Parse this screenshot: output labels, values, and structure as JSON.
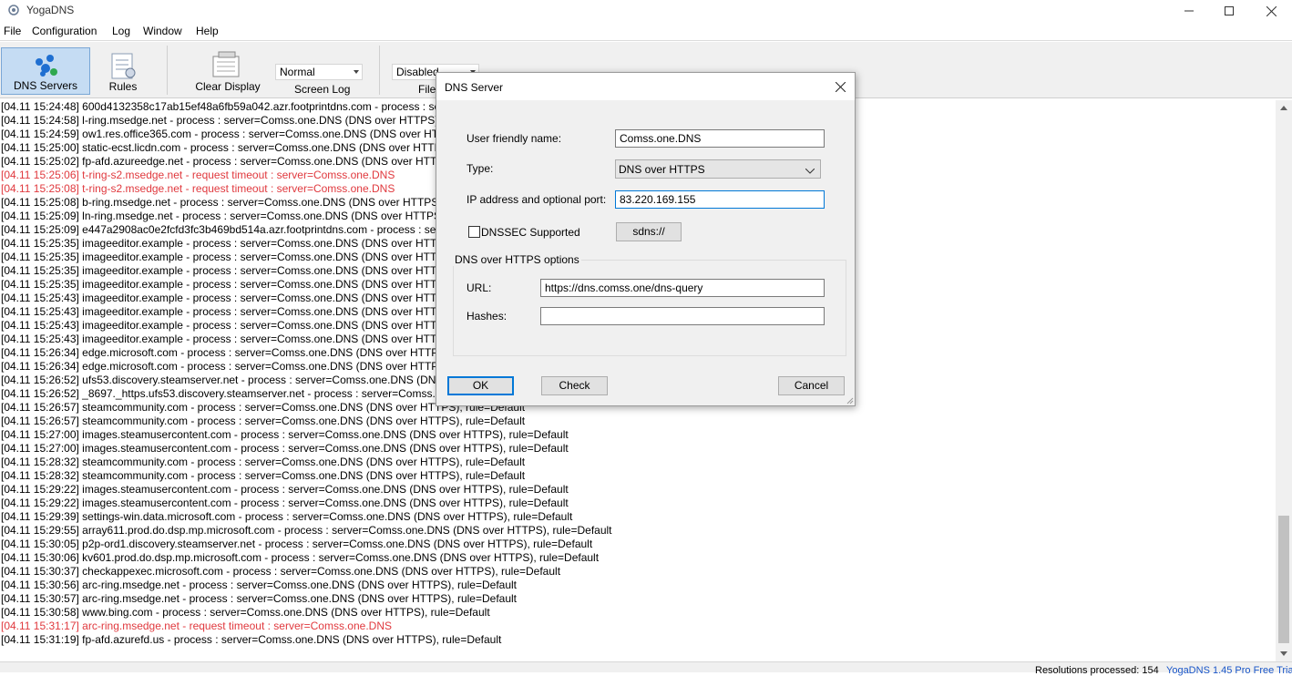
{
  "window": {
    "title": "YogaDNS"
  },
  "menu": [
    "File",
    "Configuration",
    "Log",
    "Window",
    "Help"
  ],
  "toolbar": {
    "dns_servers": "DNS Servers",
    "rules": "Rules",
    "clear_display": "Clear Display",
    "screen_log": "Screen Log",
    "screen_log_value": "Normal",
    "file_label": "File",
    "file_value": "Disabled"
  },
  "log": [
    {
      "text": "[04.11 15:24:48] 600d4132358c17ab15ef48a6fb59a042.azr.footprintdns.com - process : server",
      "error": false
    },
    {
      "text": "[04.11 15:24:58] l-ring.msedge.net - process : server=Comss.one.DNS (DNS over HTTPS), rule",
      "error": false
    },
    {
      "text": "[04.11 15:24:59] ow1.res.office365.com - process : server=Comss.one.DNS (DNS over HTTPS",
      "error": false
    },
    {
      "text": "[04.11 15:25:00] static-ecst.licdn.com - process : server=Comss.one.DNS (DNS over HTTPS),",
      "error": false
    },
    {
      "text": "[04.11 15:25:02] fp-afd.azureedge.net - process : server=Comss.one.DNS (DNS over HTTPS),",
      "error": false
    },
    {
      "text": "[04.11 15:25:06] t-ring-s2.msedge.net - request timeout : server=Comss.one.DNS",
      "error": true
    },
    {
      "text": "[04.11 15:25:08] t-ring-s2.msedge.net - request timeout : server=Comss.one.DNS",
      "error": true
    },
    {
      "text": "[04.11 15:25:08] b-ring.msedge.net - process : server=Comss.one.DNS (DNS over HTTPS), ru",
      "error": false
    },
    {
      "text": "[04.11 15:25:09] ln-ring.msedge.net - process : server=Comss.one.DNS (DNS over HTTPS), r",
      "error": false
    },
    {
      "text": "[04.11 15:25:09] e447a2908ac0e2fcfd3fc3b469bd514a.azr.footprintdns.com - process : server",
      "error": false
    },
    {
      "text": "[04.11 15:25:35] imageeditor.example - process : server=Comss.one.DNS (DNS over HTTPS",
      "error": false
    },
    {
      "text": "[04.11 15:25:35] imageeditor.example - process : server=Comss.one.DNS (DNS over HTTPS",
      "error": false
    },
    {
      "text": "[04.11 15:25:35] imageeditor.example - process : server=Comss.one.DNS (DNS over HTTPS",
      "error": false
    },
    {
      "text": "[04.11 15:25:35] imageeditor.example - process : server=Comss.one.DNS (DNS over HTTPS",
      "error": false
    },
    {
      "text": "[04.11 15:25:43] imageeditor.example - process : server=Comss.one.DNS (DNS over HTTPS",
      "error": false
    },
    {
      "text": "[04.11 15:25:43] imageeditor.example - process : server=Comss.one.DNS (DNS over HTTPS",
      "error": false
    },
    {
      "text": "[04.11 15:25:43] imageeditor.example - process : server=Comss.one.DNS (DNS over HTTPS",
      "error": false
    },
    {
      "text": "[04.11 15:25:43] imageeditor.example - process : server=Comss.one.DNS (DNS over HTTPS",
      "error": false
    },
    {
      "text": "[04.11 15:26:34] edge.microsoft.com - process : server=Comss.one.DNS (DNS over HTTPS), r",
      "error": false
    },
    {
      "text": "[04.11 15:26:34] edge.microsoft.com - process : server=Comss.one.DNS (DNS over HTTPS), r",
      "error": false
    },
    {
      "text": "[04.11 15:26:52] ufs53.discovery.steamserver.net - process : server=Comss.one.DNS (DNS ov",
      "error": false
    },
    {
      "text": "[04.11 15:26:52] _8697._https.ufs53.discovery.steamserver.net - process : server=Comss.one.",
      "error": false
    },
    {
      "text": "[04.11 15:26:57] steamcommunity.com - process : server=Comss.one.DNS (DNS over HTTPS), rule=Default",
      "error": false
    },
    {
      "text": "[04.11 15:26:57] steamcommunity.com - process : server=Comss.one.DNS (DNS over HTTPS), rule=Default",
      "error": false
    },
    {
      "text": "[04.11 15:27:00] images.steamusercontent.com - process : server=Comss.one.DNS (DNS over HTTPS), rule=Default",
      "error": false
    },
    {
      "text": "[04.11 15:27:00] images.steamusercontent.com - process : server=Comss.one.DNS (DNS over HTTPS), rule=Default",
      "error": false
    },
    {
      "text": "[04.11 15:28:32] steamcommunity.com - process : server=Comss.one.DNS (DNS over HTTPS), rule=Default",
      "error": false
    },
    {
      "text": "[04.11 15:28:32] steamcommunity.com - process : server=Comss.one.DNS (DNS over HTTPS), rule=Default",
      "error": false
    },
    {
      "text": "[04.11 15:29:22] images.steamusercontent.com - process : server=Comss.one.DNS (DNS over HTTPS), rule=Default",
      "error": false
    },
    {
      "text": "[04.11 15:29:22] images.steamusercontent.com - process : server=Comss.one.DNS (DNS over HTTPS), rule=Default",
      "error": false
    },
    {
      "text": "[04.11 15:29:39] settings-win.data.microsoft.com - process : server=Comss.one.DNS (DNS over HTTPS), rule=Default",
      "error": false
    },
    {
      "text": "[04.11 15:29:55] array611.prod.do.dsp.mp.microsoft.com - process : server=Comss.one.DNS (DNS over HTTPS), rule=Default",
      "error": false
    },
    {
      "text": "[04.11 15:30:05] p2p-ord1.discovery.steamserver.net - process : server=Comss.one.DNS (DNS over HTTPS), rule=Default",
      "error": false
    },
    {
      "text": "[04.11 15:30:06] kv601.prod.do.dsp.mp.microsoft.com - process : server=Comss.one.DNS (DNS over HTTPS), rule=Default",
      "error": false
    },
    {
      "text": "[04.11 15:30:37] checkappexec.microsoft.com - process : server=Comss.one.DNS (DNS over HTTPS), rule=Default",
      "error": false
    },
    {
      "text": "[04.11 15:30:56] arc-ring.msedge.net - process : server=Comss.one.DNS (DNS over HTTPS), rule=Default",
      "error": false
    },
    {
      "text": "[04.11 15:30:57] arc-ring.msedge.net - process : server=Comss.one.DNS (DNS over HTTPS), rule=Default",
      "error": false
    },
    {
      "text": "[04.11 15:30:58] www.bing.com - process : server=Comss.one.DNS (DNS over HTTPS), rule=Default",
      "error": false
    },
    {
      "text": "[04.11 15:31:17] arc-ring.msedge.net - request timeout : server=Comss.one.DNS",
      "error": true
    },
    {
      "text": "[04.11 15:31:19] fp-afd.azurefd.us - process : server=Comss.one.DNS (DNS over HTTPS), rule=Default",
      "error": false
    }
  ],
  "status": {
    "resolutions": "Resolutions processed: 154",
    "version": "YogaDNS 1.45 Pro Free Trial"
  },
  "dialog": {
    "title": "DNS Server",
    "name_label": "User friendly name:",
    "name_value": "Comss.one.DNS",
    "type_label": "Type:",
    "type_value": "DNS over HTTPS",
    "ip_label": "IP address and optional port:",
    "ip_value": "83.220.169.155",
    "dnssec_label": "DNSSEC Supported",
    "sdns_button": "sdns://",
    "group_label": "DNS over HTTPS options",
    "url_label": "URL:",
    "url_value": "https://dns.comss.one/dns-query",
    "hashes_label": "Hashes:",
    "hashes_value": "",
    "ok": "OK",
    "check": "Check",
    "cancel": "Cancel"
  },
  "colors": {
    "error_text": "#e0393e",
    "accent": "#0078d7",
    "active_tool": "#c5dcf3",
    "status_link": "#1a56c8"
  }
}
